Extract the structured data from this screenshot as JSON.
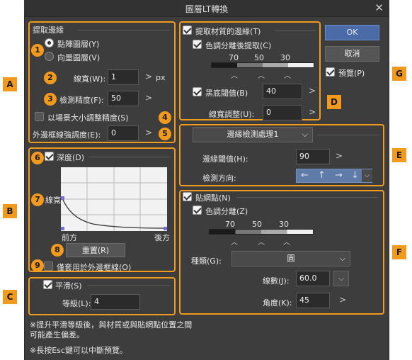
{
  "window": {
    "title": "圖層LT轉換",
    "close_icon": "close-icon"
  },
  "extract_edge": {
    "title": "提取邊緣",
    "radio_raster": "點陣圖層(Y)",
    "radio_vector": "向量圖層(V)",
    "line_width_label": "線寬(W):",
    "line_width_value": "1",
    "line_width_unit": "px",
    "precision_label": "檢測精度(F):",
    "precision_value": "50",
    "scale_adjust_label": "以場景大小調整精度(S)",
    "outer_strength_label": "外邊框線強調度(E):",
    "outer_strength_value": "0"
  },
  "depth": {
    "title": "深度(D)",
    "curve_label": "線寬",
    "front_label": "前方",
    "back_label": "後方",
    "reset_label": "重置(R)",
    "apply_outer_label": "僅套用於外邊框線(O)"
  },
  "smooth": {
    "title": "平滑(S)",
    "level_label": "等級(L):",
    "level_value": "4"
  },
  "notes": {
    "line1": "※提升平滑等級後，與材質或與貼網點位置之間",
    "line2": "可能產生偏差。",
    "line3": "※長按Esc鍵可以中斷預覽。"
  },
  "texture": {
    "title": "提取材質的邊緣(T)",
    "posterize_label": "色調分離後提取(C)",
    "poster_values": [
      "70",
      "50",
      "30"
    ],
    "black_threshold_label": "黑底閾值(B)",
    "black_threshold_value": "40",
    "line_width_adjust_label": "線寬調整(U):",
    "line_width_adjust_value": "0"
  },
  "edge_process": {
    "mode_value": "邊緣檢測處理1",
    "threshold_label": "邊緣閾值(H):",
    "threshold_value": "90",
    "direction_label": "檢測方向:"
  },
  "halftone": {
    "title": "貼網點(N)",
    "posterize_label": "色調分離(Z)",
    "poster_values": [
      "70",
      "50",
      "30"
    ],
    "type_label": "種類(G):",
    "type_value": "圓",
    "lines_label": "線數(J):",
    "lines_value": "60.0",
    "angle_label": "角度(K):",
    "angle_value": "45"
  },
  "actions": {
    "ok": "OK",
    "cancel": "取消",
    "preview": "預覽(P)"
  },
  "markers": {
    "letters": [
      "A",
      "B",
      "C",
      "D",
      "E",
      "F",
      "G"
    ],
    "numbers": [
      "1",
      "2",
      "3",
      "4",
      "5",
      "6",
      "7",
      "8",
      "9"
    ]
  },
  "colors": {
    "accent": "#f29a1d",
    "primary": "#4a6aa8",
    "dialog_bg": "#3d3d3d"
  }
}
